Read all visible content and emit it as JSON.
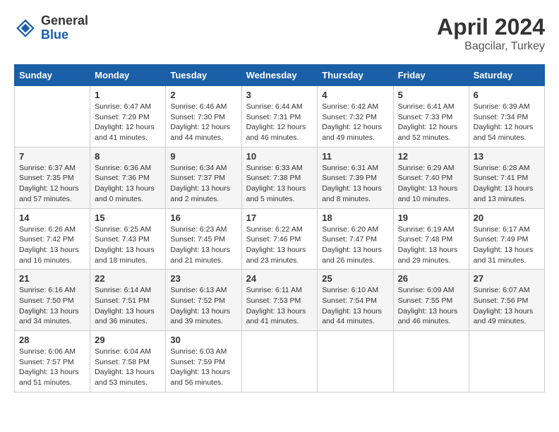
{
  "logo": {
    "general": "General",
    "blue": "Blue"
  },
  "title": {
    "month": "April 2024",
    "location": "Bagcilar, Turkey"
  },
  "days_header": [
    "Sunday",
    "Monday",
    "Tuesday",
    "Wednesday",
    "Thursday",
    "Friday",
    "Saturday"
  ],
  "weeks": [
    [
      {
        "day": "",
        "info": ""
      },
      {
        "day": "1",
        "info": "Sunrise: 6:47 AM\nSunset: 7:29 PM\nDaylight: 12 hours\nand 41 minutes."
      },
      {
        "day": "2",
        "info": "Sunrise: 6:46 AM\nSunset: 7:30 PM\nDaylight: 12 hours\nand 44 minutes."
      },
      {
        "day": "3",
        "info": "Sunrise: 6:44 AM\nSunset: 7:31 PM\nDaylight: 12 hours\nand 46 minutes."
      },
      {
        "day": "4",
        "info": "Sunrise: 6:42 AM\nSunset: 7:32 PM\nDaylight: 12 hours\nand 49 minutes."
      },
      {
        "day": "5",
        "info": "Sunrise: 6:41 AM\nSunset: 7:33 PM\nDaylight: 12 hours\nand 52 minutes."
      },
      {
        "day": "6",
        "info": "Sunrise: 6:39 AM\nSunset: 7:34 PM\nDaylight: 12 hours\nand 54 minutes."
      }
    ],
    [
      {
        "day": "7",
        "info": "Sunrise: 6:37 AM\nSunset: 7:35 PM\nDaylight: 12 hours\nand 57 minutes."
      },
      {
        "day": "8",
        "info": "Sunrise: 6:36 AM\nSunset: 7:36 PM\nDaylight: 13 hours\nand 0 minutes."
      },
      {
        "day": "9",
        "info": "Sunrise: 6:34 AM\nSunset: 7:37 PM\nDaylight: 13 hours\nand 2 minutes."
      },
      {
        "day": "10",
        "info": "Sunrise: 6:33 AM\nSunset: 7:38 PM\nDaylight: 13 hours\nand 5 minutes."
      },
      {
        "day": "11",
        "info": "Sunrise: 6:31 AM\nSunset: 7:39 PM\nDaylight: 13 hours\nand 8 minutes."
      },
      {
        "day": "12",
        "info": "Sunrise: 6:29 AM\nSunset: 7:40 PM\nDaylight: 13 hours\nand 10 minutes."
      },
      {
        "day": "13",
        "info": "Sunrise: 6:28 AM\nSunset: 7:41 PM\nDaylight: 13 hours\nand 13 minutes."
      }
    ],
    [
      {
        "day": "14",
        "info": "Sunrise: 6:26 AM\nSunset: 7:42 PM\nDaylight: 13 hours\nand 16 minutes."
      },
      {
        "day": "15",
        "info": "Sunrise: 6:25 AM\nSunset: 7:43 PM\nDaylight: 13 hours\nand 18 minutes."
      },
      {
        "day": "16",
        "info": "Sunrise: 6:23 AM\nSunset: 7:45 PM\nDaylight: 13 hours\nand 21 minutes."
      },
      {
        "day": "17",
        "info": "Sunrise: 6:22 AM\nSunset: 7:46 PM\nDaylight: 13 hours\nand 23 minutes."
      },
      {
        "day": "18",
        "info": "Sunrise: 6:20 AM\nSunset: 7:47 PM\nDaylight: 13 hours\nand 26 minutes."
      },
      {
        "day": "19",
        "info": "Sunrise: 6:19 AM\nSunset: 7:48 PM\nDaylight: 13 hours\nand 29 minutes."
      },
      {
        "day": "20",
        "info": "Sunrise: 6:17 AM\nSunset: 7:49 PM\nDaylight: 13 hours\nand 31 minutes."
      }
    ],
    [
      {
        "day": "21",
        "info": "Sunrise: 6:16 AM\nSunset: 7:50 PM\nDaylight: 13 hours\nand 34 minutes."
      },
      {
        "day": "22",
        "info": "Sunrise: 6:14 AM\nSunset: 7:51 PM\nDaylight: 13 hours\nand 36 minutes."
      },
      {
        "day": "23",
        "info": "Sunrise: 6:13 AM\nSunset: 7:52 PM\nDaylight: 13 hours\nand 39 minutes."
      },
      {
        "day": "24",
        "info": "Sunrise: 6:11 AM\nSunset: 7:53 PM\nDaylight: 13 hours\nand 41 minutes."
      },
      {
        "day": "25",
        "info": "Sunrise: 6:10 AM\nSunset: 7:54 PM\nDaylight: 13 hours\nand 44 minutes."
      },
      {
        "day": "26",
        "info": "Sunrise: 6:09 AM\nSunset: 7:55 PM\nDaylight: 13 hours\nand 46 minutes."
      },
      {
        "day": "27",
        "info": "Sunrise: 6:07 AM\nSunset: 7:56 PM\nDaylight: 13 hours\nand 49 minutes."
      }
    ],
    [
      {
        "day": "28",
        "info": "Sunrise: 6:06 AM\nSunset: 7:57 PM\nDaylight: 13 hours\nand 51 minutes."
      },
      {
        "day": "29",
        "info": "Sunrise: 6:04 AM\nSunset: 7:58 PM\nDaylight: 13 hours\nand 53 minutes."
      },
      {
        "day": "30",
        "info": "Sunrise: 6:03 AM\nSunset: 7:59 PM\nDaylight: 13 hours\nand 56 minutes."
      },
      {
        "day": "",
        "info": ""
      },
      {
        "day": "",
        "info": ""
      },
      {
        "day": "",
        "info": ""
      },
      {
        "day": "",
        "info": ""
      }
    ]
  ]
}
